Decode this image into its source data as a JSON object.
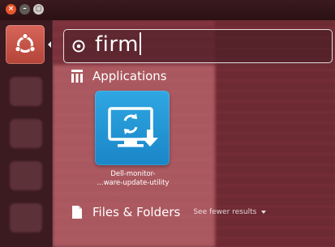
{
  "window": {
    "close_glyph": "×",
    "minimize_glyph": "–",
    "maximize_glyph": "◻"
  },
  "launcher": {
    "bfb_icon": "ubuntu-logo-icon"
  },
  "search": {
    "query": "firm",
    "icon": "search-icon"
  },
  "sections": {
    "applications": {
      "label": "Applications",
      "icon": "applications-icon"
    },
    "files": {
      "label": "Files & Folders",
      "icon": "file-icon",
      "toggle_label": "See fewer results"
    }
  },
  "results": {
    "app": {
      "label_line1": "Dell-monitor-",
      "label_line2": "...ware-update-utility",
      "icon": "monitor-refresh-download-icon"
    }
  },
  "colors": {
    "accent": "#e6562b",
    "tile": "#1f95d6",
    "bfb": "#c4503f"
  }
}
